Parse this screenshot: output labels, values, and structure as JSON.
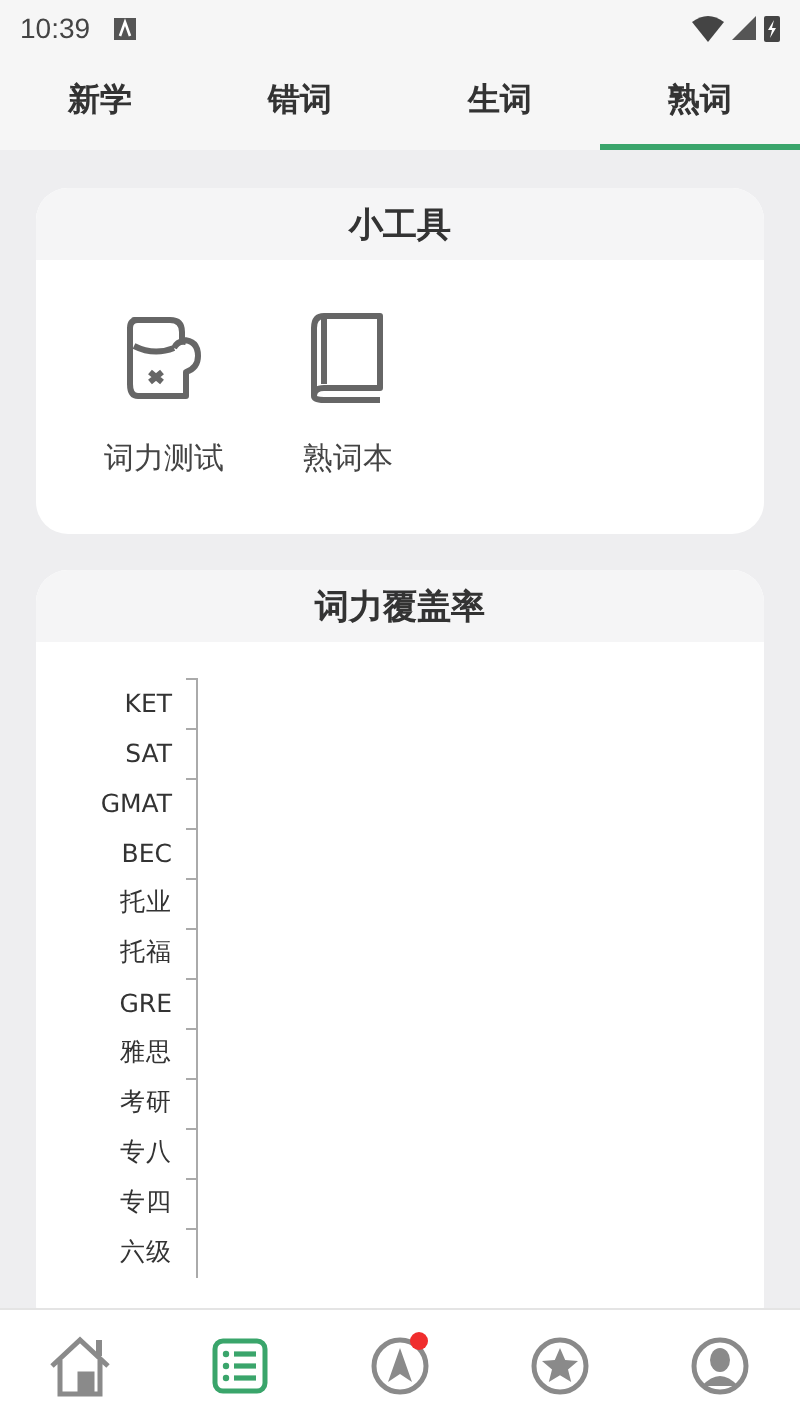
{
  "status_bar": {
    "time": "10:39"
  },
  "tabs": [
    {
      "label": "新学",
      "selected": false
    },
    {
      "label": "错词",
      "selected": false
    },
    {
      "label": "生词",
      "selected": false
    },
    {
      "label": "熟词",
      "selected": true
    }
  ],
  "tools": {
    "title": "小工具",
    "items": [
      {
        "kind": "glove",
        "label": "词力测试"
      },
      {
        "kind": "book",
        "label": "熟词本"
      }
    ]
  },
  "coverage": {
    "title": "词力覆盖率",
    "axis_labels": [
      "KET",
      "SAT",
      "GMAT",
      "BEC",
      "托业",
      "托福",
      "GRE",
      "雅思",
      "考研",
      "专八",
      "专四",
      "六级"
    ]
  },
  "bottom_nav": [
    {
      "kind": "home",
      "selected": false,
      "badge": false
    },
    {
      "kind": "list",
      "selected": true,
      "badge": false
    },
    {
      "kind": "compass",
      "selected": false,
      "badge": true
    },
    {
      "kind": "star",
      "selected": false,
      "badge": false
    },
    {
      "kind": "user",
      "selected": false,
      "badge": false
    }
  ]
}
